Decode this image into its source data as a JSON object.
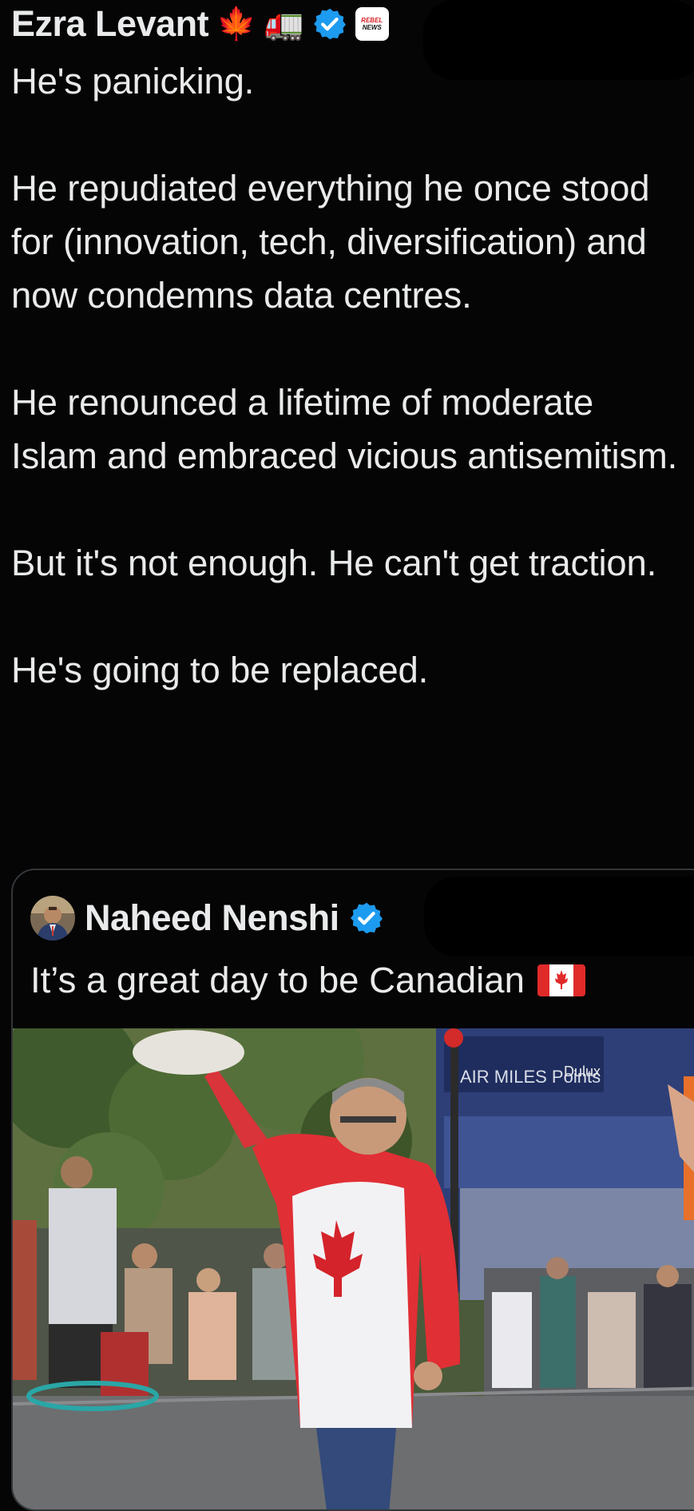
{
  "author": {
    "name": "Ezra Levant",
    "emojis": [
      "🍁",
      "🚛"
    ],
    "affiliate_badge": {
      "line1": "REBEL",
      "line2": "NEWS"
    }
  },
  "tweet": {
    "paragraphs": [
      "He's panicking.",
      "He repudiated everything he once stood for (innovation, tech, diversification) and now condemns data centres.",
      "He renounced a lifetime of moderate Islam and embraced vicious antisemitism.",
      "But it's not enough. He can't get traction.",
      "He's going to be replaced."
    ]
  },
  "quoted": {
    "name": "Naheed Nenshi",
    "text": "It’s a great day to be Canadian",
    "media": {
      "sign_text": "AIR MILES Points",
      "store_text": "Dulux"
    }
  },
  "colors": {
    "background": "#050505",
    "text": "#e9eaeb",
    "verified": "#1d9bf0",
    "border": "#33363a"
  }
}
